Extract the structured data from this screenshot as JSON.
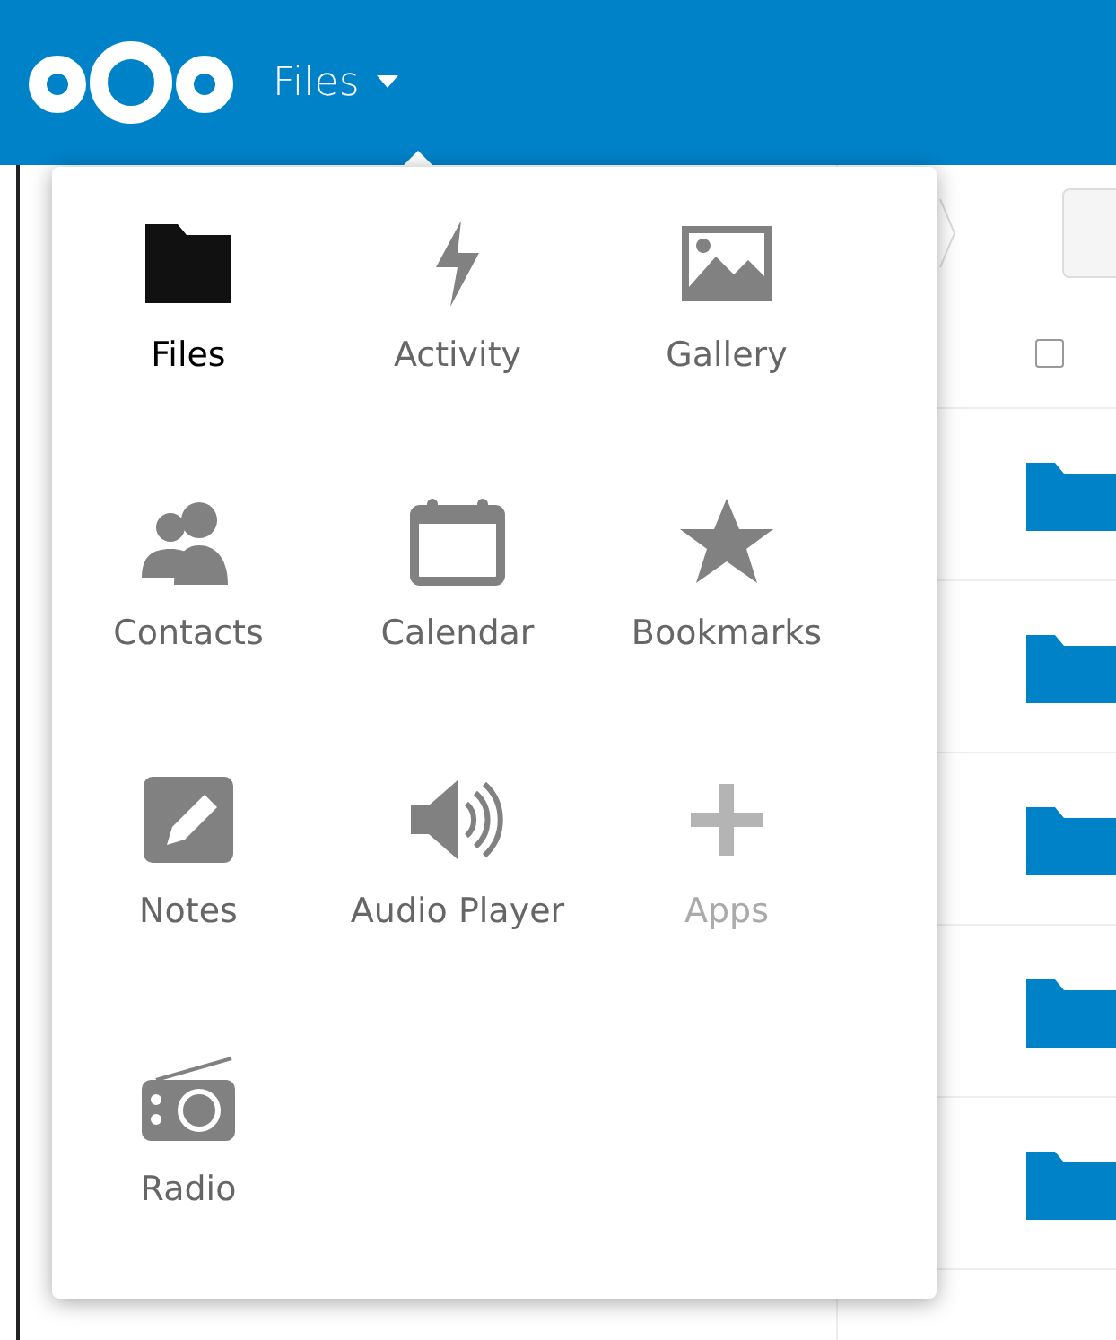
{
  "header": {
    "app_title": "Files"
  },
  "app_menu": {
    "items": [
      {
        "label": "Files",
        "kind": "folder",
        "selected": true,
        "muted": false
      },
      {
        "label": "Activity",
        "kind": "bolt",
        "selected": false,
        "muted": false
      },
      {
        "label": "Gallery",
        "kind": "image",
        "selected": false,
        "muted": false
      },
      {
        "label": "Contacts",
        "kind": "people",
        "selected": false,
        "muted": false
      },
      {
        "label": "Calendar",
        "kind": "calendar",
        "selected": false,
        "muted": false
      },
      {
        "label": "Bookmarks",
        "kind": "star",
        "selected": false,
        "muted": false
      },
      {
        "label": "Notes",
        "kind": "note",
        "selected": false,
        "muted": false
      },
      {
        "label": "Audio Player",
        "kind": "speaker",
        "selected": false,
        "muted": false
      },
      {
        "label": "Apps",
        "kind": "plus",
        "selected": false,
        "muted": true
      },
      {
        "label": "Radio",
        "kind": "radio",
        "selected": false,
        "muted": false
      }
    ]
  },
  "file_list": {
    "select_all": {
      "checked": false
    },
    "rows": [
      {
        "kind": "folder"
      },
      {
        "kind": "folder"
      },
      {
        "kind": "folder"
      },
      {
        "kind": "folder"
      },
      {
        "kind": "folder"
      }
    ]
  }
}
